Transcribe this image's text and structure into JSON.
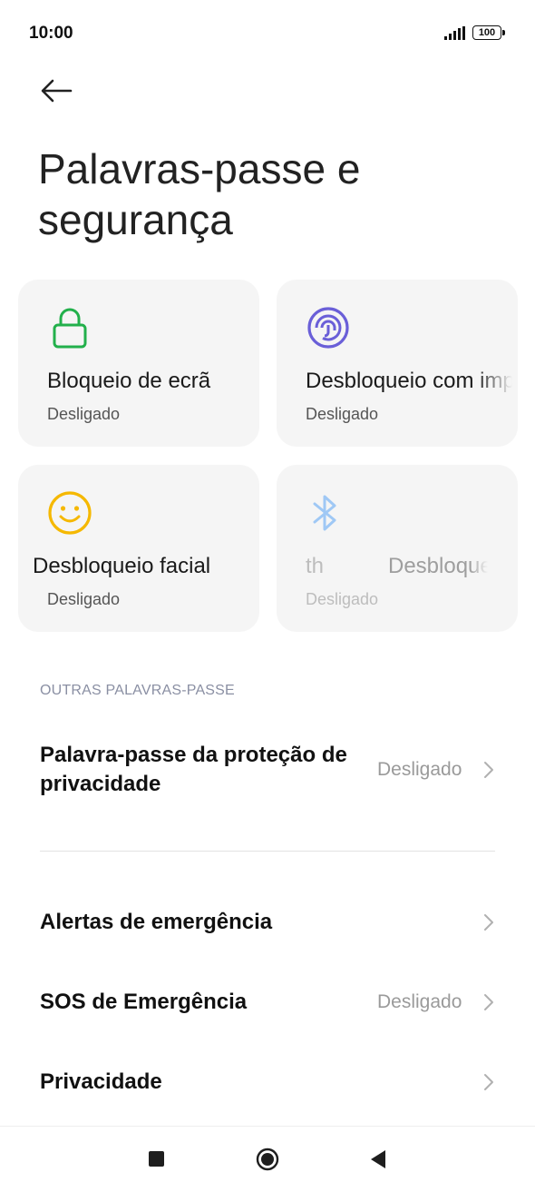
{
  "status_bar": {
    "time": "10:00",
    "battery": "100"
  },
  "header": {
    "title": "Palavras-passe e segurança"
  },
  "cards": [
    {
      "label": "Bloqueio de ecrã",
      "status": "Desligado",
      "icon": "lock-icon",
      "color": "#22b04b"
    },
    {
      "label": "Desbloqueio com impressão digital",
      "status": "Desligado",
      "icon": "fingerprint-icon",
      "color": "#6a5fd8"
    },
    {
      "label": "Desbloqueio facial",
      "status": "Desligado",
      "icon": "face-smile-icon",
      "color": "#f5b800"
    },
    {
      "label_prefix": "th",
      "label": "Desbloqueio",
      "status": "Desligado",
      "icon": "bluetooth-icon",
      "color": "#9fc8f5"
    }
  ],
  "section": {
    "header": "OUTRAS PALAVRAS-PASSE"
  },
  "rows": [
    {
      "title": "Palavra-passe da proteção de privacidade",
      "value": "Desligado"
    },
    {
      "title": "Alertas de emergência",
      "value": ""
    },
    {
      "title": "SOS de Emergência",
      "value": "Desligado"
    },
    {
      "title": "Privacidade",
      "value": ""
    }
  ]
}
